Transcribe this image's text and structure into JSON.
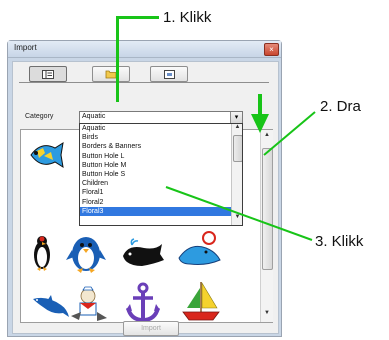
{
  "annotations": {
    "step1": "1. Klikk",
    "step2": "2. Dra",
    "step3": "3. Klikk"
  },
  "window": {
    "title": "Import",
    "close_glyph": "×"
  },
  "category": {
    "label": "Category",
    "selected": "Aquatic",
    "arrow_glyph": "▾"
  },
  "dropdown": {
    "items": [
      "Aquatic",
      "Birds",
      "Borders & Banners",
      "Button Hole L",
      "Button Hole M",
      "Button Hole S",
      "Children",
      "Floral1",
      "Floral2",
      "Floral3"
    ],
    "highlighted_index": 9
  },
  "import_button": "Import",
  "icons": {
    "tab1": "list-view-icon",
    "tab2": "folder-icon",
    "tab3": "card-icon",
    "arrow": "down-arrow-icon"
  },
  "colors": {
    "annotation_green": "#18c418",
    "selection_blue": "#3178e0"
  }
}
